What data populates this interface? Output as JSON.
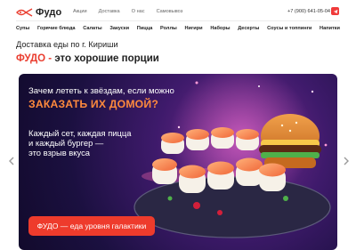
{
  "brand": {
    "name": "Фудо",
    "accent": "#ea3d2f"
  },
  "top_nav": [
    "Акции",
    "Доставка",
    "О нас",
    "Самовывоз"
  ],
  "phone": "+7 (900) 641-05-04",
  "categories": [
    "Супы",
    "Горячие блюда",
    "Салаты",
    "Закуски",
    "Пицца",
    "Роллы",
    "Нигири",
    "Наборы",
    "Десерты",
    "Соусы и топпинги",
    "Напитки"
  ],
  "subtitle": "Доставка еды по г. Кириши",
  "headline": {
    "brand": "ФУДО -",
    "rest": " это хорошие порции"
  },
  "banner": {
    "line1": "Зачем лететь к звёздам, если можно",
    "line2": "ЗАКАЗАТЬ ИХ ДОМОЙ?",
    "body": [
      "Каждый сет, каждая пицца",
      "и каждый бургер —",
      "это взрыв вкуса"
    ],
    "cta": "ФУДО — еда уровня галактики"
  },
  "icons": [
    "logo-icon",
    "telegram-icon",
    "arrow-left-icon",
    "arrow-right-icon"
  ]
}
